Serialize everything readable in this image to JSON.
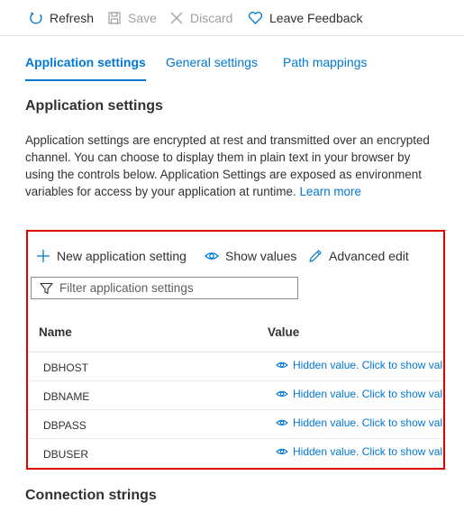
{
  "toolbar": {
    "refresh": "Refresh",
    "save": "Save",
    "discard": "Discard",
    "feedback": "Leave Feedback"
  },
  "tabs": [
    {
      "label": "Application settings",
      "active": true
    },
    {
      "label": "General settings",
      "active": false
    },
    {
      "label": "Path mappings",
      "active": false
    }
  ],
  "section": {
    "title": "Application settings",
    "description": "Application settings are encrypted at rest and transmitted over an encrypted channel. You can choose to display them in plain text in your browser by using the controls below. Application Settings are exposed as environment variables for access by your application at runtime.",
    "learn_more": "Learn more"
  },
  "settings_toolbar": {
    "new": "New application setting",
    "show_values": "Show values",
    "advanced_edit": "Advanced edit"
  },
  "filter": {
    "placeholder": "Filter application settings",
    "value": ""
  },
  "table": {
    "columns": [
      "Name",
      "Value"
    ],
    "rows": [
      {
        "name": "DBHOST",
        "value": "Hidden value. Click to show value"
      },
      {
        "name": "DBNAME",
        "value": "Hidden value. Click to show value"
      },
      {
        "name": "DBPASS",
        "value": "Hidden value. Click to show value"
      },
      {
        "name": "DBUSER",
        "value": "Hidden value. Click to show value"
      }
    ]
  },
  "next_section": {
    "title": "Connection strings"
  },
  "colors": {
    "accent": "#0078d4",
    "highlight_border": "#e00000",
    "text": "#323130",
    "disabled": "#a19f9d"
  },
  "icons": {
    "refresh": "refresh-icon",
    "save": "save-icon",
    "discard": "close-icon",
    "feedback": "heart-icon",
    "new": "plus-icon",
    "show": "eye-icon",
    "edit": "pencil-icon",
    "filter": "filter-icon"
  }
}
